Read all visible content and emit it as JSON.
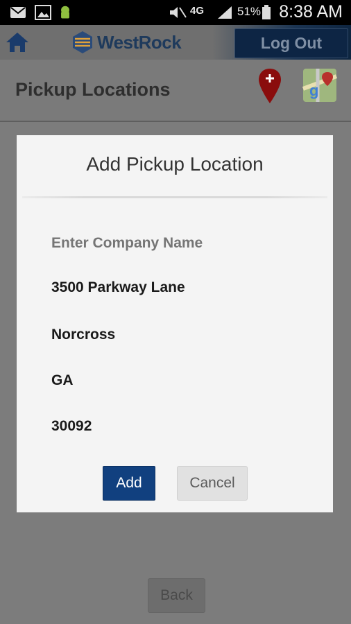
{
  "status_bar": {
    "battery_percent": "51%",
    "network": "4G",
    "time": "8:38 AM",
    "icons": [
      "message-icon",
      "image-icon",
      "android-icon",
      "mute-icon",
      "signal-icon",
      "battery-icon"
    ]
  },
  "header": {
    "home_icon": "home-icon",
    "brand": "WestRock",
    "logout_label": "Log Out"
  },
  "page": {
    "title": "Pickup Locations",
    "icons": [
      "add-location-pin-icon",
      "google-maps-icon"
    ]
  },
  "dialog": {
    "title": "Add Pickup Location",
    "company_placeholder": "Enter Company Name",
    "company_value": "",
    "address": "3500 Parkway Lane",
    "city": "Norcross",
    "state": "GA",
    "zip": "30092",
    "add_label": "Add",
    "cancel_label": "Cancel"
  },
  "footer": {
    "back_label": "Back"
  },
  "colors": {
    "primary_button": "#11407f",
    "header_accent": "#0d2544",
    "pin_red": "#b01010"
  }
}
